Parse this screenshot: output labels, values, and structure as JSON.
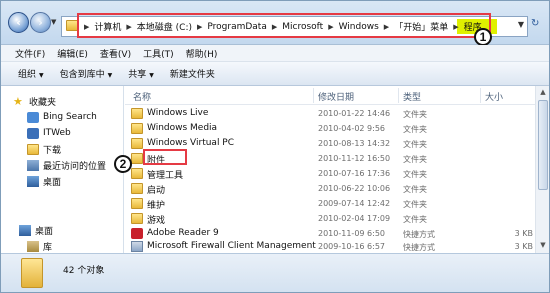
{
  "address": {
    "crumbs": [
      "计算机",
      "本地磁盘 (C:)",
      "ProgramData",
      "Microsoft",
      "Windows",
      "「开始」菜单",
      "程序"
    ],
    "step_marker_1": "1"
  },
  "menu": [
    "文件(F)",
    "编辑(E)",
    "查看(V)",
    "工具(T)",
    "帮助(H)"
  ],
  "toolbar": [
    "组织",
    "包含到库中",
    "共享",
    "新建文件夹"
  ],
  "navpane": {
    "items": [
      {
        "label": "收藏夹",
        "icon": "star-icon"
      },
      {
        "label": "Bing Search",
        "icon": "bing-icon"
      },
      {
        "label": "ITWeb",
        "icon": "itweb-icon"
      },
      {
        "label": "下载",
        "icon": "download-folder-icon"
      },
      {
        "label": "最近访问的位置",
        "icon": "recent-places-icon"
      },
      {
        "label": "桌面",
        "icon": "desktop-icon"
      },
      {
        "label": "桌面",
        "icon": "desktop-icon"
      },
      {
        "label": "库",
        "icon": "library-icon"
      }
    ]
  },
  "columns": {
    "name": "名称",
    "date": "修改日期",
    "type": "类型",
    "size": "大小"
  },
  "files": [
    {
      "name": "Windows Live",
      "date": "2010-01-22 14:46",
      "type": "文件夹",
      "size": "",
      "icon": "folder-icon"
    },
    {
      "name": "Windows Media",
      "date": "2010-04-02 9:56",
      "type": "文件夹",
      "size": "",
      "icon": "folder-icon"
    },
    {
      "name": "Windows Virtual PC",
      "date": "2010-08-13 14:32",
      "type": "文件夹",
      "size": "",
      "icon": "folder-icon"
    },
    {
      "name": "附件",
      "date": "2010-11-12 16:50",
      "type": "文件夹",
      "size": "",
      "icon": "folder-icon"
    },
    {
      "name": "管理工具",
      "date": "2010-07-16 17:36",
      "type": "文件夹",
      "size": "",
      "icon": "folder-icon"
    },
    {
      "name": "启动",
      "date": "2010-06-22 10:06",
      "type": "文件夹",
      "size": "",
      "icon": "folder-icon"
    },
    {
      "name": "维护",
      "date": "2009-07-14 12:42",
      "type": "文件夹",
      "size": "",
      "icon": "folder-icon"
    },
    {
      "name": "游戏",
      "date": "2010-02-04 17:09",
      "type": "文件夹",
      "size": "",
      "icon": "folder-icon"
    },
    {
      "name": "Adobe Reader 9",
      "date": "2010-11-09 6:50",
      "type": "快捷方式",
      "size": "3 KB",
      "icon": "adobe-reader-icon"
    },
    {
      "name": "Microsoft Firewall Client Management",
      "date": "2009-10-16 6:57",
      "type": "快捷方式",
      "size": "3 KB",
      "icon": "firewall-client-icon"
    }
  ],
  "step_marker_2": "2",
  "status": {
    "count": "42 个对象"
  },
  "colors": {
    "highlight": "#e53a44",
    "folder": "#e8b93a"
  }
}
